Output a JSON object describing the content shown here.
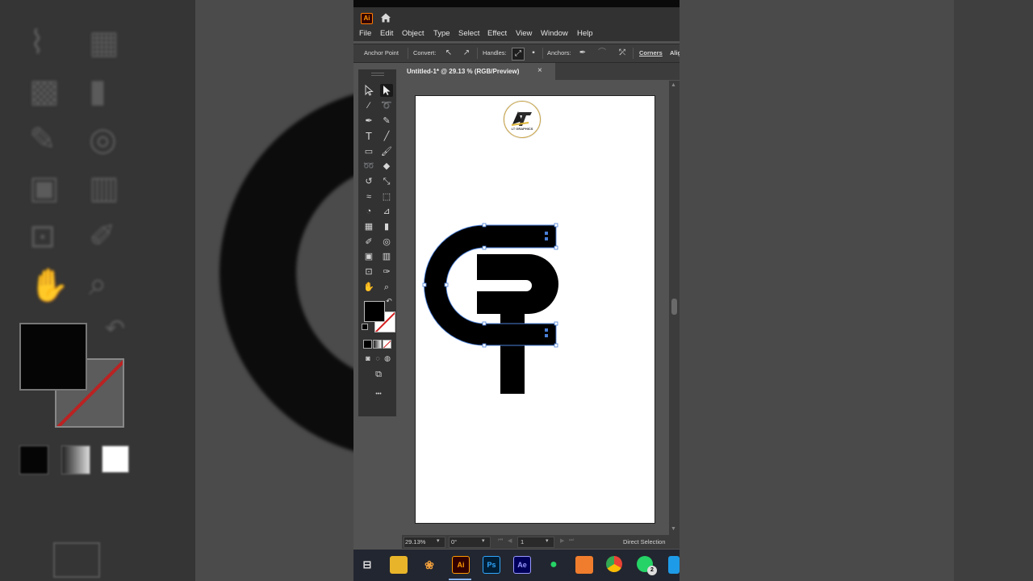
{
  "app": {
    "logo_text": "Ai",
    "menu": [
      "File",
      "Edit",
      "Object",
      "Type",
      "Select",
      "Effect",
      "View",
      "Window",
      "Help"
    ]
  },
  "control_bar": {
    "tool_name": "Anchor Point",
    "convert_label": "Convert:",
    "handles_label": "Handles:",
    "anchors_label": "Anchors:",
    "corners_label": "Corners",
    "align_label": "Alig"
  },
  "document": {
    "tab_title": "Untitled-1* @ 29.13 % (RGB/Preview)",
    "close_glyph": "×",
    "watermark_text": "LT",
    "watermark_sub": "LT GRAPHICS"
  },
  "status_bar": {
    "zoom": "29.13%",
    "rotation": "0°",
    "artboard_number": "1",
    "current_tool": "Direct Selection"
  },
  "toolbar": {
    "more_glyph": "•••",
    "fill_color": "#000000",
    "stroke_color": "none"
  },
  "taskbar": {
    "icons": [
      "task-view-icon",
      "file-explorer-icon",
      "photo-app-icon",
      "illustrator-icon",
      "photoshop-icon",
      "after-effects-icon",
      "whatsapp-desktop-icon",
      "app-icon",
      "chrome-icon",
      "whatsapp-icon",
      "store-icon"
    ],
    "ps_label": "Ps",
    "ae_label": "Ae",
    "ai_label": "Ai",
    "badge": "2"
  },
  "colors": {
    "accent": "#ff9a00",
    "selection": "#4a7fd8",
    "ui_dark": "#323232",
    "artboard": "#ffffff"
  }
}
